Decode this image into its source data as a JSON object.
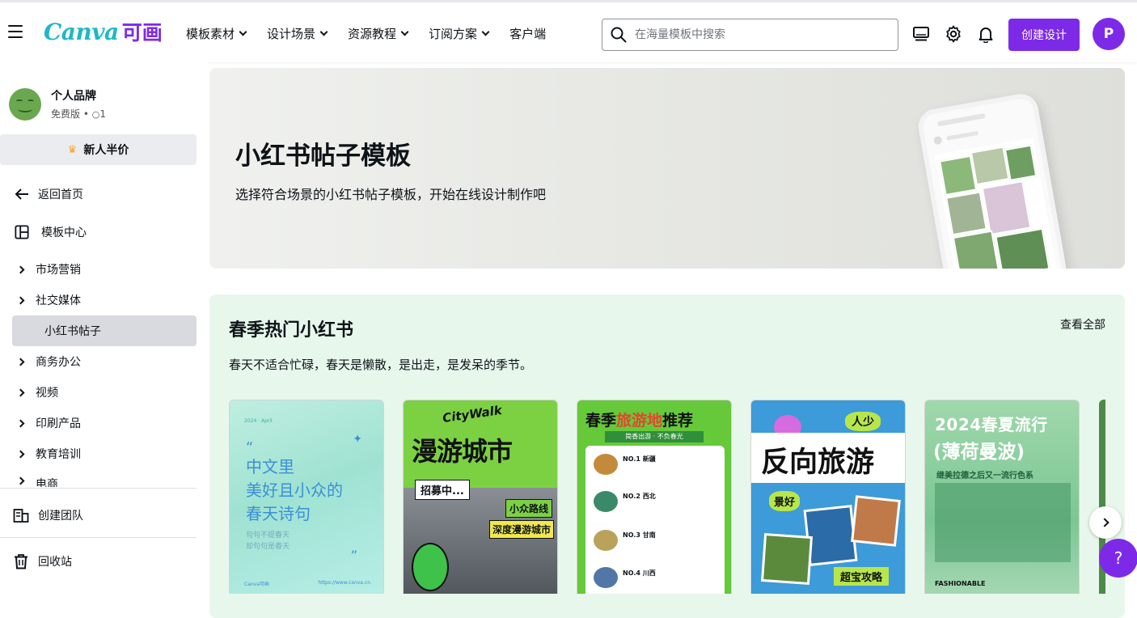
{
  "header": {
    "logo_latin": "Canva",
    "logo_cjk": "可画",
    "nav": [
      "模板素材",
      "设计场景",
      "资源教程",
      "订阅方案",
      "客户端"
    ],
    "search_placeholder": "在海量模板中搜索",
    "create_label": "创建设计",
    "avatar_initial": "P"
  },
  "sidebar": {
    "brand_name": "个人品牌",
    "brand_plan": "免费版 • ",
    "brand_members": "1",
    "promo": "新人半价",
    "back_home": "返回首页",
    "template_center": "模板中心",
    "categories": [
      "市场营销",
      "社交媒体",
      "小红书帖子",
      "商务办公",
      "视频",
      "印刷产品",
      "教育培训",
      "电商"
    ],
    "create_team": "创建团队",
    "trash": "回收站"
  },
  "hero": {
    "title": "小红书帖子模板",
    "subtitle": "选择符合场景的小红书帖子模板，开始在线设计制作吧"
  },
  "section": {
    "title": "春季热门小红书",
    "see_all": "查看全部",
    "description": "春天不适合忙碌，春天是懒散，是出走，是发呆的季节。"
  },
  "cards": [
    {
      "lines": [
        "中文里",
        "美好且小众的",
        "春天诗句"
      ],
      "top": "2024 · April",
      "footer": "Canva可画",
      "url": "https://www.canva.cn",
      "poem": [
        "句句不提春天",
        "却句句是春天"
      ]
    },
    {
      "script": "CityWalk",
      "title": "漫游城市",
      "recruit": "招募中...",
      "tag1": "小众路线",
      "tag2": "深度漫游城市"
    },
    {
      "title_a": "春季",
      "title_b": "旅游地",
      "title_c": "推荐",
      "subtitle": "简香出游 · 不负春光",
      "items": [
        "NO.1 新疆",
        "NO.2 西北",
        "NO.3 甘南",
        "NO.4 川西"
      ]
    },
    {
      "top": "人少",
      "title": "反向旅游",
      "tag": "景好",
      "bottom": "超宝攻略"
    },
    {
      "title": "2024春夏流行",
      "subtitle": "(薄荷曼波)",
      "tagline": "继美拉德之后又一流行色系",
      "bottom": "FASHIONABLE"
    }
  ],
  "colors": {
    "brand_purple": "#7d2ae8",
    "logo_teal": "#1eb8c8",
    "section_bg": "#e8f7ec"
  }
}
